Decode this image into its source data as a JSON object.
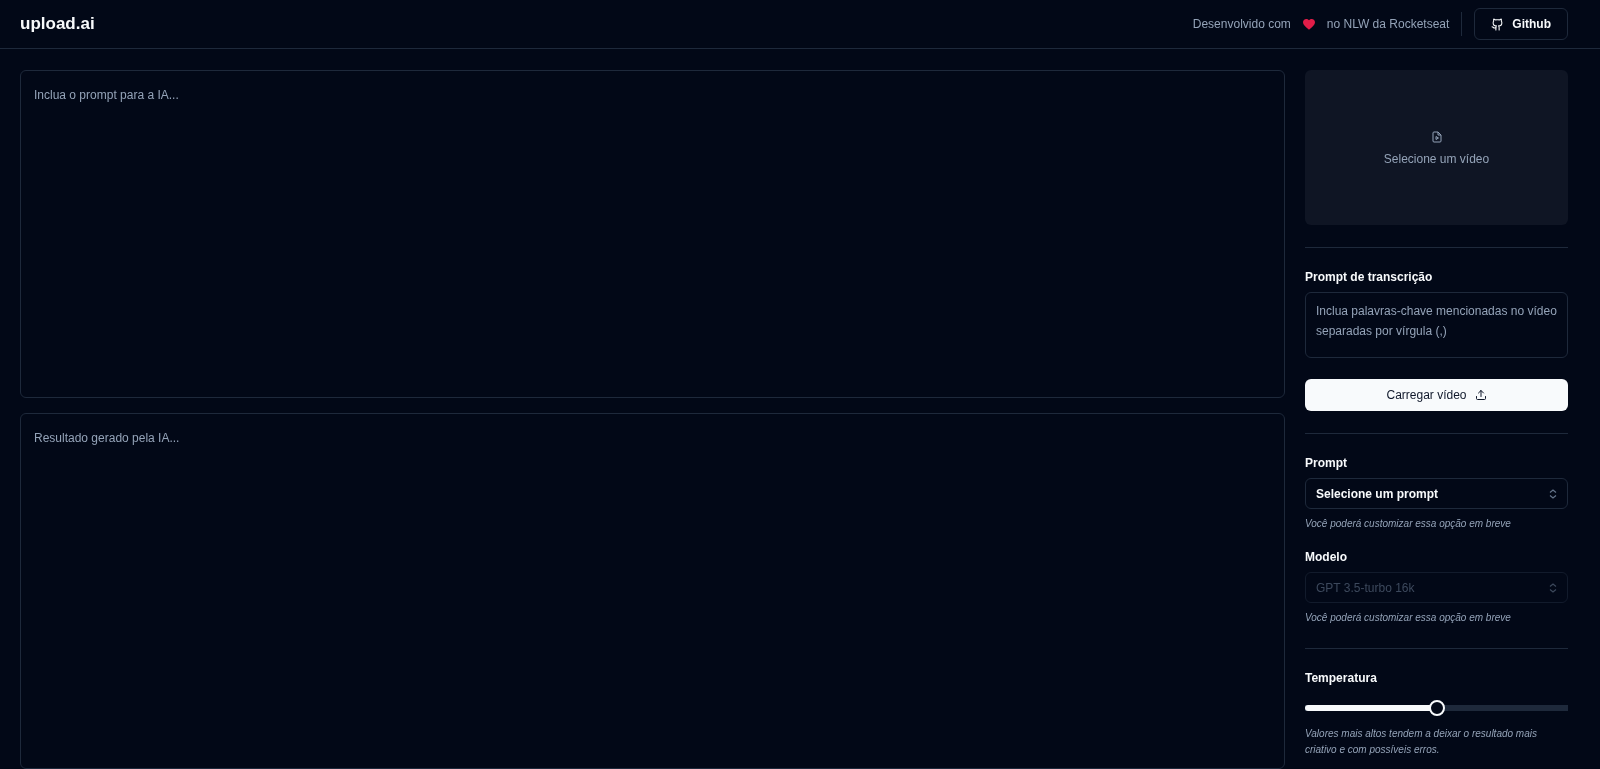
{
  "header": {
    "logo": "upload.ai",
    "credit_before": "Desenvolvido com",
    "credit_after": "no NLW da Rocketseat",
    "github_button": "Github"
  },
  "editor": {
    "prompt_placeholder": "Inclua o prompt para a IA...",
    "result_placeholder": "Resultado gerado pela IA..."
  },
  "video_input": {
    "label": "Selecione um vídeo"
  },
  "transcription": {
    "label": "Prompt de transcrição",
    "placeholder": "Inclua palavras-chave mencionadas no vídeo separadas por vírgula (,)",
    "button": "Carregar vídeo"
  },
  "prompt_select": {
    "label": "Prompt",
    "value": "Selecione um prompt",
    "disabled": false,
    "hint": "Você poderá customizar essa opção em breve"
  },
  "model_select": {
    "label": "Modelo",
    "value": "GPT 3.5-turbo 16k",
    "disabled": true,
    "hint": "Você poderá customizar essa opção em breve"
  },
  "temperature": {
    "label": "Temperatura",
    "level": 0.5,
    "hint": "Valores mais altos tendem a deixar o resultado mais criativo e com possíveis erros."
  }
}
